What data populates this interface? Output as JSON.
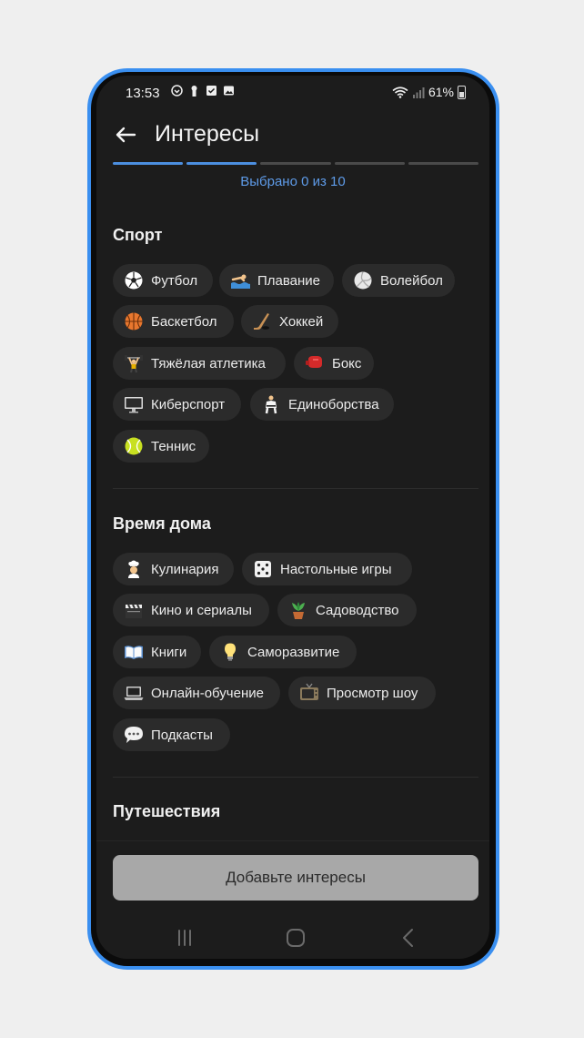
{
  "status_bar": {
    "time": "13:53",
    "battery": "61%"
  },
  "app_bar": {
    "title": "Интересы"
  },
  "progress": {
    "segments": 5,
    "active": 2
  },
  "counter": "Выбрано 0 из 10",
  "sections": [
    {
      "title": "Спорт",
      "chips": [
        {
          "label": "Футбол",
          "icon": "soccer-ball-icon"
        },
        {
          "label": "Плавание",
          "icon": "swimming-icon"
        },
        {
          "label": "Волейбол",
          "icon": "volleyball-icon"
        },
        {
          "label": "Баскетбол",
          "icon": "basketball-icon"
        },
        {
          "label": "Хоккей",
          "icon": "hockey-stick-icon"
        },
        {
          "label": "Тяжёлая атлетика",
          "icon": "weightlifter-icon"
        },
        {
          "label": "Бокс",
          "icon": "boxing-glove-icon"
        },
        {
          "label": "Киберспорт",
          "icon": "monitor-icon"
        },
        {
          "label": "Единоборства",
          "icon": "martial-arts-icon"
        },
        {
          "label": "Теннис",
          "icon": "tennis-ball-icon"
        }
      ]
    },
    {
      "title": "Время дома",
      "chips": [
        {
          "label": "Кулинария",
          "icon": "cook-icon"
        },
        {
          "label": "Настольные игры",
          "icon": "dice-icon"
        },
        {
          "label": "Кино и сериалы",
          "icon": "clapper-board-icon"
        },
        {
          "label": "Садоводство",
          "icon": "potted-plant-icon"
        },
        {
          "label": "Книги",
          "icon": "open-book-icon"
        },
        {
          "label": "Саморазвитие",
          "icon": "light-bulb-icon"
        },
        {
          "label": "Онлайн-обучение",
          "icon": "laptop-icon"
        },
        {
          "label": "Просмотр шоу",
          "icon": "television-icon"
        },
        {
          "label": "Подкасты",
          "icon": "speech-bubble-icon"
        }
      ]
    },
    {
      "title": "Путешествия",
      "chips": []
    }
  ],
  "cta_label": "Добавьте интересы",
  "colors": {
    "accent": "#4c8fe0",
    "background": "#1c1c1c",
    "chip": "#2b2b2b",
    "cta_disabled": "#a8a8a8"
  }
}
